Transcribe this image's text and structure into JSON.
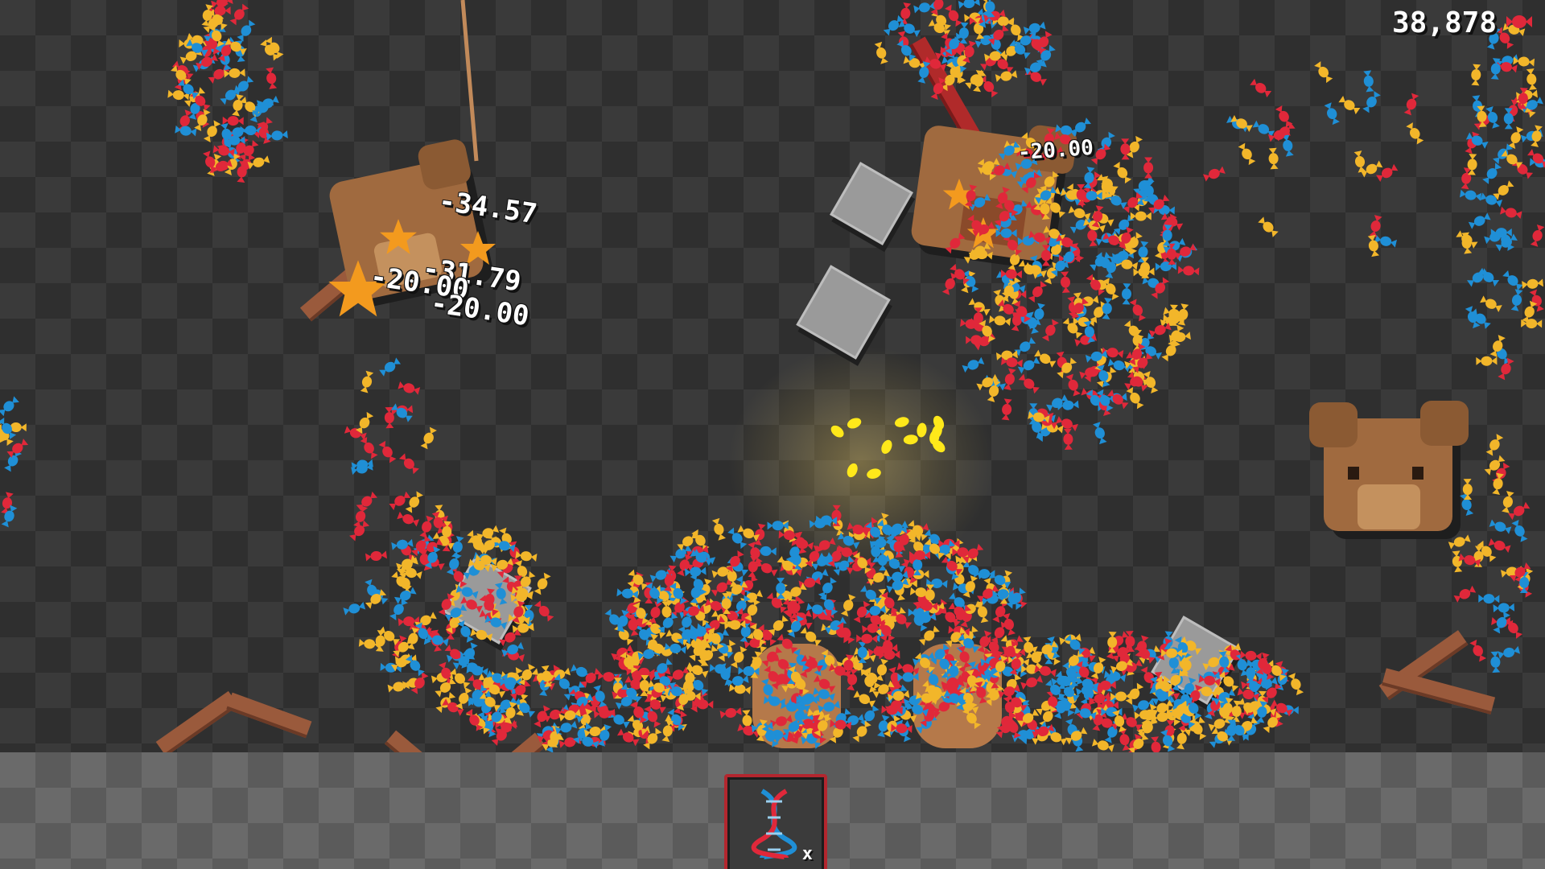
{
  "hud": {
    "score": "38,878",
    "score_icon": "candy-icon"
  },
  "damage_numbers": [
    "-34.57",
    "-31.79",
    "-20.00",
    "-20.00",
    "-20.00"
  ],
  "toolbar": {
    "slot_icon": "dna-icon",
    "slot_count": "x"
  },
  "colors": {
    "candy": [
      "#f2b62a",
      "#1f8fd6",
      "#e0283a"
    ],
    "bear": "#a06a3f",
    "floor": "#6a6a6a",
    "slot_border": "#b3262e"
  }
}
